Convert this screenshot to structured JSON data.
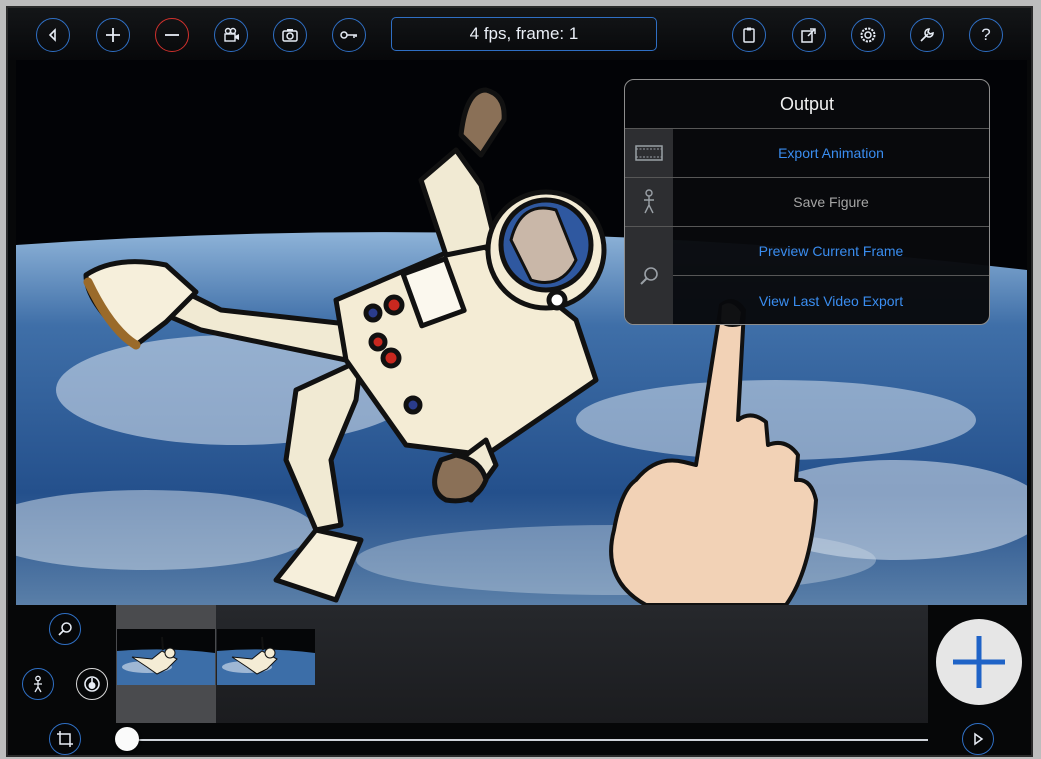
{
  "toolbar": {
    "status_text": "4 fps, frame: 1",
    "buttons": [
      "back-icon",
      "add-icon",
      "remove-icon",
      "movie-camera-icon",
      "camera-icon",
      "key-icon",
      "clipboard-icon",
      "export-icon",
      "settings-icon",
      "wrench-icon",
      "help-icon"
    ],
    "help_label": "?"
  },
  "output_menu": {
    "title": "Output",
    "items": [
      {
        "label": "Export Animation",
        "icon": "film-strip-icon",
        "enabled": true
      },
      {
        "label": "Save Figure",
        "icon": "stick-figure-icon",
        "enabled": false
      },
      {
        "label": "Preview Current Frame",
        "icon": "magnifier-icon",
        "enabled": true
      },
      {
        "label": "View Last Video Export",
        "icon": "",
        "enabled": true
      }
    ]
  },
  "timeline": {
    "frame_count": 2,
    "selected_frame": 1,
    "playhead_position": 0
  },
  "colors": {
    "accent_blue": "#2f6fc4",
    "link_blue": "#3a8df0",
    "remove_red": "#d0312d"
  }
}
